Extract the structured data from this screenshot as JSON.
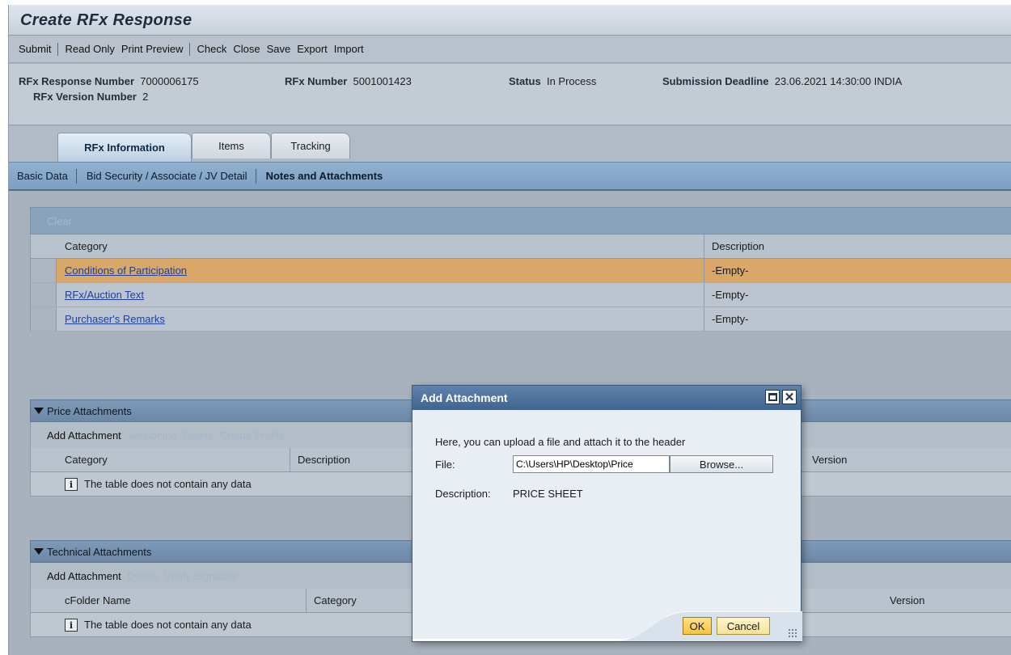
{
  "title": "Create RFx Response",
  "toolbar": {
    "submit": "Submit",
    "read_only": "Read Only",
    "print_preview": "Print Preview",
    "check": "Check",
    "close": "Close",
    "save": "Save",
    "export": "Export",
    "import": "Import"
  },
  "header": {
    "response_number_label": "RFx Response Number",
    "response_number": "7000006175",
    "rfx_number_label": "RFx Number",
    "rfx_number": "5001001423",
    "status_label": "Status",
    "status": "In Process",
    "deadline_label": "Submission Deadline",
    "deadline": "23.06.2021 14:30:00 INDIA",
    "version_label": "RFx Version Number",
    "version": "2"
  },
  "tabs": [
    "RFx Information",
    "Items",
    "Tracking"
  ],
  "subnav": [
    "Basic Data",
    "Bid Security / Associate / JV Detail",
    "Notes and Attachments"
  ],
  "notes": {
    "clear": "Clear",
    "columns": [
      "Category",
      "Description"
    ],
    "rows": [
      {
        "category": "Conditions of Participation",
        "description": "-Empty-"
      },
      {
        "category": "RFx/Auction Text",
        "description": "-Empty-"
      },
      {
        "category": "Purchaser's Remarks",
        "description": "-Empty-"
      }
    ]
  },
  "price_attachments": {
    "title": "Price Attachments",
    "tools": [
      "Add Attachment",
      "Versioning",
      "Delete",
      "Create Profile"
    ],
    "columns": [
      "Category",
      "Description",
      "Version"
    ],
    "empty": "The table does not contain any data"
  },
  "technical_attachments": {
    "title": "Technical Attachments",
    "tools": [
      "Add Attachment",
      "Delete",
      "Verify Signature"
    ],
    "columns": [
      "cFolder Name",
      "Category",
      "Version"
    ],
    "empty": "The table does not contain any data"
  },
  "dialog": {
    "title": "Add Attachment",
    "message": "Here, you can upload a file and attach it to the header",
    "file_label": "File:",
    "file_value": "C:\\Users\\HP\\Desktop\\Price",
    "browse": "Browse...",
    "description_label": "Description:",
    "description_value": "PRICE SHEET",
    "ok": "OK",
    "cancel": "Cancel"
  },
  "colors": {
    "selected_row": "#d9a767",
    "section_header": "#6b88a8",
    "dialog_title": "#3f6590"
  }
}
